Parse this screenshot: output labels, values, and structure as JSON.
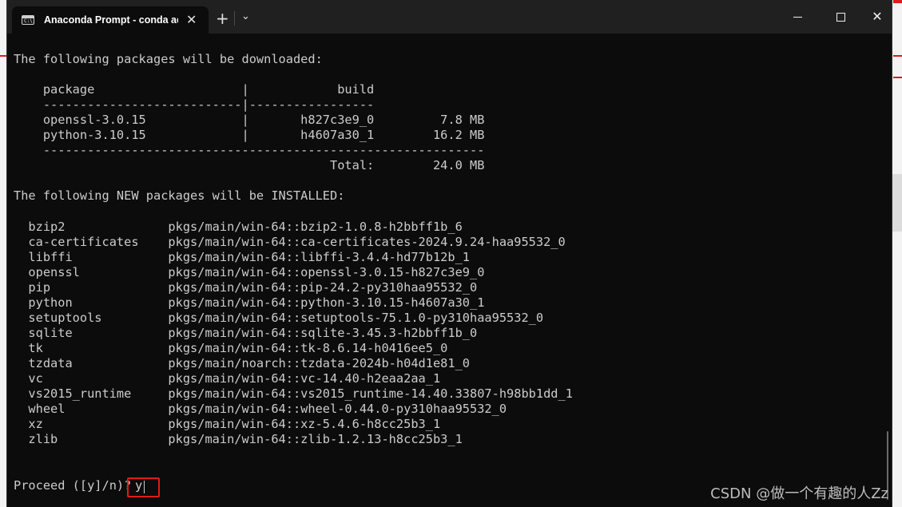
{
  "window": {
    "tab_title": "Anaconda Prompt - conda ac",
    "tab_icon_text": "C:\\",
    "new_tab_glyph": "+",
    "dropdown_glyph": "⌄",
    "close_glyph": "✕"
  },
  "terminal": {
    "lines": [
      "The following packages will be downloaded:",
      "",
      "    package                    |            build",
      "    ---------------------------|-----------------",
      "    openssl-3.0.15             |       h827c3e9_0         7.8 MB",
      "    python-3.10.15             |       h4607a30_1        16.2 MB",
      "    ------------------------------------------------------------",
      "                                           Total:        24.0 MB",
      "",
      "The following NEW packages will be INSTALLED:",
      "",
      "  bzip2              pkgs/main/win-64::bzip2-1.0.8-h2bbff1b_6",
      "  ca-certificates    pkgs/main/win-64::ca-certificates-2024.9.24-haa95532_0",
      "  libffi             pkgs/main/win-64::libffi-3.4.4-hd77b12b_1",
      "  openssl            pkgs/main/win-64::openssl-3.0.15-h827c3e9_0",
      "  pip                pkgs/main/win-64::pip-24.2-py310haa95532_0",
      "  python             pkgs/main/win-64::python-3.10.15-h4607a30_1",
      "  setuptools         pkgs/main/win-64::setuptools-75.1.0-py310haa95532_0",
      "  sqlite             pkgs/main/win-64::sqlite-3.45.3-h2bbff1b_0",
      "  tk                 pkgs/main/win-64::tk-8.6.14-h0416ee5_0",
      "  tzdata             pkgs/main/noarch::tzdata-2024b-h04d1e81_0",
      "  vc                 pkgs/main/win-64::vc-14.40-h2eaa2aa_1",
      "  vs2015_runtime     pkgs/main/win-64::vs2015_runtime-14.40.33807-h98bb1dd_1",
      "  wheel              pkgs/main/win-64::wheel-0.44.0-py310haa95532_0",
      "  xz                 pkgs/main/win-64::xz-5.4.6-h8cc25b3_1",
      "  zlib               pkgs/main/win-64::zlib-1.2.13-h8cc25b3_1"
    ],
    "prompt": "Proceed ([y]/n)?",
    "input_value": "y"
  },
  "watermark": "CSDN @做一个有趣的人Zz",
  "colors": {
    "terminal_bg": "#0c0c0c",
    "terminal_fg": "#cccccc",
    "titlebar_bg": "#202020",
    "highlight": "#e01a1a"
  }
}
